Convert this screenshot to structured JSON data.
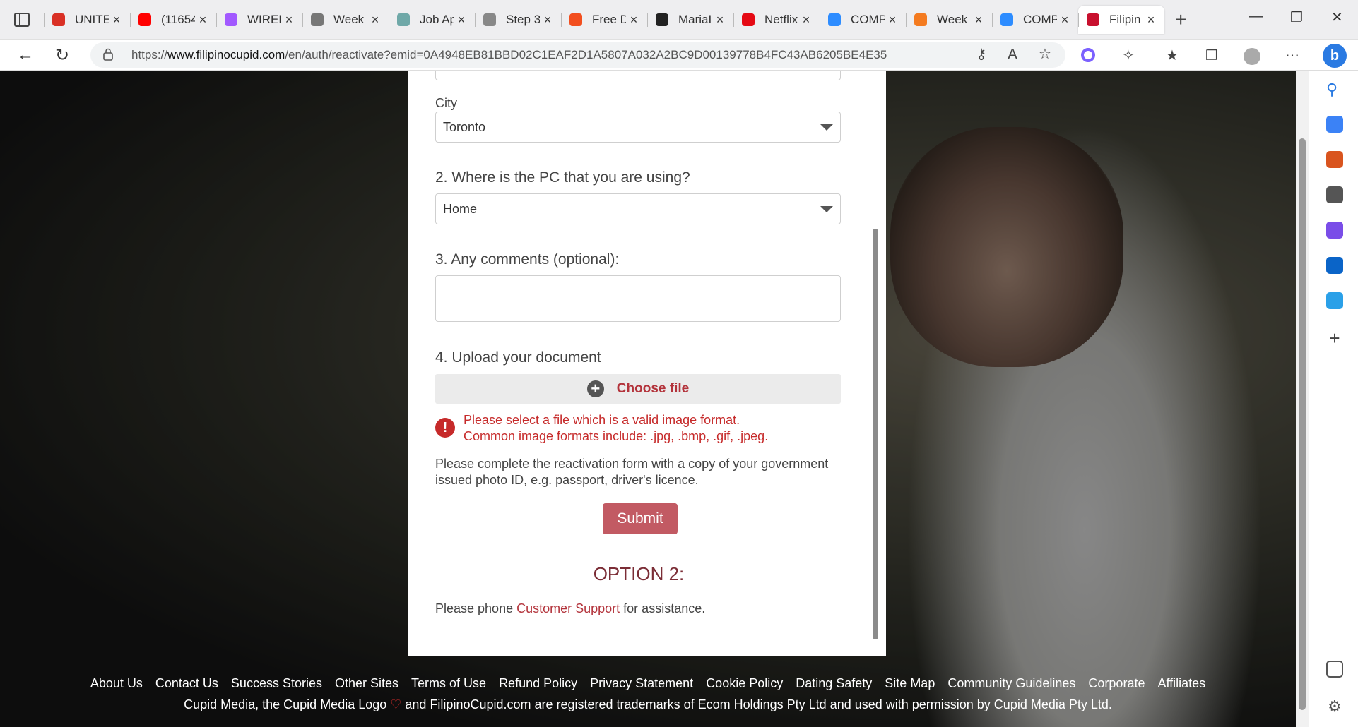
{
  "browser": {
    "tabs": [
      {
        "label": "UNITE",
        "icon": "gmail-icon",
        "color": "#d93025"
      },
      {
        "label": "(11654",
        "icon": "youtube-icon",
        "color": "#ff0000"
      },
      {
        "label": "WIREF",
        "icon": "figma-icon",
        "color": "#a259ff"
      },
      {
        "label": "Week",
        "icon": "document-icon",
        "color": "#777777"
      },
      {
        "label": "Job Ap",
        "icon": "globe-icon",
        "color": "#6fa8a8"
      },
      {
        "label": "Step 3",
        "icon": "grid-icon",
        "color": "#888888"
      },
      {
        "label": "Free D",
        "icon": "figma-icon",
        "color": "#f24e1e"
      },
      {
        "label": "MariaI",
        "icon": "github-icon",
        "color": "#222222"
      },
      {
        "label": "Netflix",
        "icon": "netflix-icon",
        "color": "#e50914"
      },
      {
        "label": "COMP",
        "icon": "zoom-icon",
        "color": "#2d8cff"
      },
      {
        "label": "Week",
        "icon": "tool-icon",
        "color": "#f47b20"
      },
      {
        "label": "COMP",
        "icon": "zoom-icon",
        "color": "#2d8cff"
      },
      {
        "label": "Filipin",
        "icon": "heart-icon",
        "color": "#c8102e"
      }
    ],
    "close_glyph": "×",
    "newtab_glyph": "+",
    "url_prefix": "https://",
    "url_domain": "www.filipinocupid.com",
    "url_path": "/en/auth/reactivate?emid=0A4948EB81BBD02C1EAF2D1A5807A032A2BC9D00139778B4FC43AB6205BE4E35"
  },
  "form": {
    "city_label": "City",
    "city_value": "Toronto",
    "q2_label": "2. Where is the PC that you are using?",
    "q2_value": "Home",
    "q3_label": "3. Any comments (optional):",
    "q4_label": "4. Upload your document",
    "choose_file": "Choose file",
    "error_line1": "Please select a file which is a valid image format.",
    "error_line2": "Common image formats include: .jpg, .bmp, .gif, .jpeg.",
    "instruction": "Please complete the reactivation form with a copy of your government issued photo ID, e.g. passport, driver's licence.",
    "submit_label": "Submit",
    "option2_title": "OPTION 2:",
    "phone_prefix": "Please phone ",
    "phone_link": "Customer Support",
    "phone_suffix": " for assistance."
  },
  "footer": {
    "links": [
      "About Us",
      "Contact Us",
      "Success Stories",
      "Other Sites",
      "Terms of Use",
      "Refund Policy",
      "Privacy Statement",
      "Cookie Policy",
      "Dating Safety",
      "Site Map",
      "Community Guidelines",
      "Corporate",
      "Affiliates"
    ],
    "copy_before": "Cupid Media, the Cupid Media Logo ",
    "copy_after": " and FilipinoCupid.com are registered trademarks of Ecom Holdings Pty Ltd and used with permission by Cupid Media Pty Ltd."
  },
  "colors": {
    "accent": "#b3333b",
    "submit_bg": "#c25a63",
    "error": "#c62a2a",
    "option_title": "#7b2d36"
  }
}
